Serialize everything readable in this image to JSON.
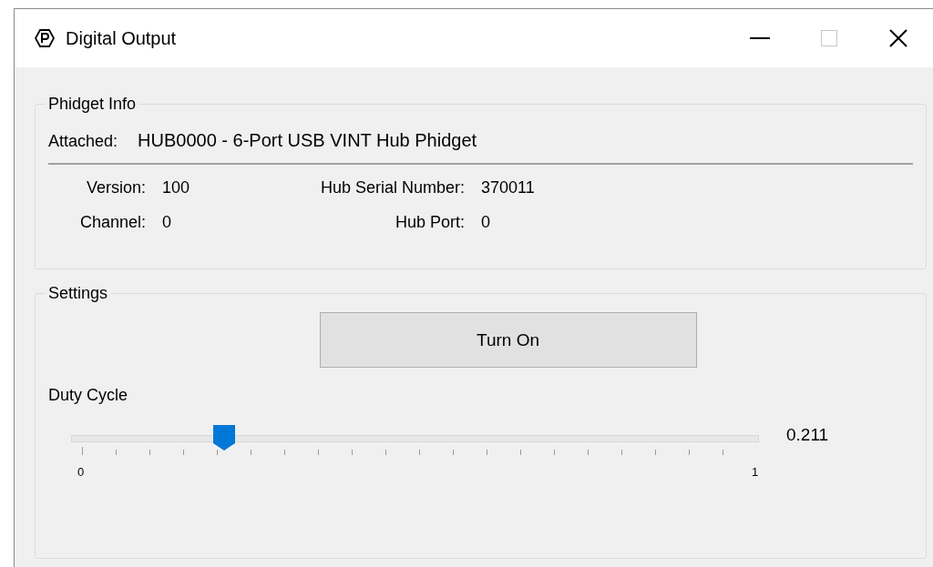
{
  "window": {
    "title": "Digital Output",
    "maximize_disabled": true
  },
  "phidget_info": {
    "title": "Phidget Info",
    "attached_label": "Attached:",
    "attached_value": "HUB0000 - 6-Port USB VINT Hub Phidget",
    "fields": [
      {
        "label": "Version:",
        "value": "100"
      },
      {
        "label": "Hub Serial Number:",
        "value": "370011"
      },
      {
        "label": "Channel:",
        "value": "0"
      },
      {
        "label": "Hub Port:",
        "value": "0"
      }
    ]
  },
  "settings": {
    "title": "Settings",
    "button": "Turn On",
    "slider": {
      "label": "Duty Cycle",
      "level": 0.211,
      "reading": "0.211",
      "min_label": "0",
      "max_label": "1"
    }
  }
}
